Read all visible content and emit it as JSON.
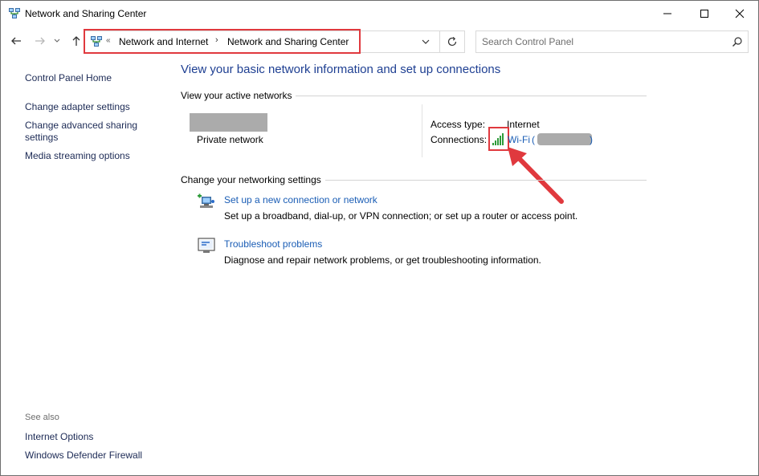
{
  "window": {
    "title": "Network and Sharing Center",
    "icon": "network-icon",
    "controls": {
      "minimize": "minimize-icon",
      "maximize": "maximize-icon",
      "close": "close-icon"
    }
  },
  "address": {
    "overflow_glyph": "«",
    "crumbs": [
      "Network and Internet",
      "Network and Sharing Center"
    ],
    "separator": "›"
  },
  "search": {
    "placeholder": "Search Control Panel"
  },
  "sidebar": {
    "home": "Control Panel Home",
    "links": [
      "Change adapter settings",
      "Change advanced sharing settings",
      "Media streaming options"
    ],
    "see_also_label": "See also",
    "see_also": [
      "Internet Options",
      "Windows Defender Firewall"
    ]
  },
  "main": {
    "heading": "View your basic network information and set up connections",
    "active_networks_label": "View your active networks",
    "network_category": "Private network",
    "access_type_label": "Access type:",
    "access_type_value": "Internet",
    "connections_label": "Connections:",
    "connection_name": "Wi-Fi",
    "connection_paren_open": "(",
    "connection_paren_close": ")",
    "change_settings_label": "Change your networking settings",
    "tasks": [
      {
        "title": "Set up a new connection or network",
        "desc": "Set up a broadband, dial-up, or VPN connection; or set up a router or access point."
      },
      {
        "title": "Troubleshoot problems",
        "desc": "Diagnose and repair network problems, or get troubleshooting information."
      }
    ]
  },
  "colors": {
    "accent_link": "#1a5db5",
    "heading": "#1e3f92",
    "annotation_red": "#e0393e"
  }
}
